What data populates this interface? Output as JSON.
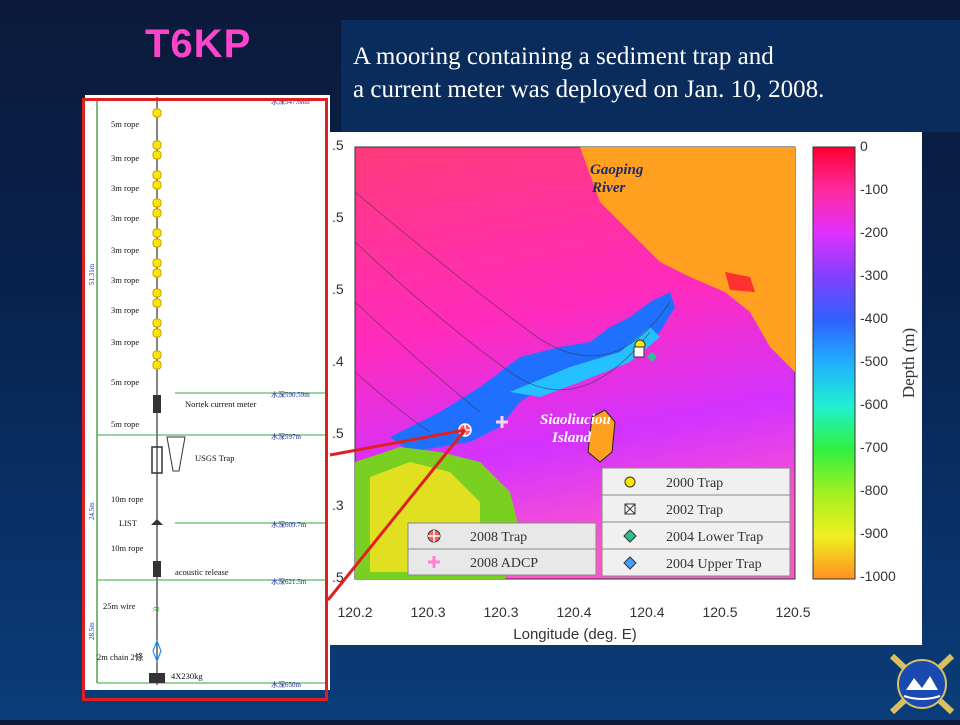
{
  "title": "T6KP",
  "caption": {
    "line1": "A mooring containing a sediment trap and",
    "line2": "a current meter was deployed on Jan. 10, 2008."
  },
  "mooring": {
    "ropes": [
      "5m rope",
      "3m rope",
      "3m rope",
      "3m rope",
      "3m rope",
      "3m rope",
      "3m rope",
      "3m rope",
      "5m rope",
      "5m rope",
      "10m rope",
      "10m rope",
      "25m wire",
      "2m chain 2條"
    ],
    "instruments": {
      "current_meter": "Nortek current meter",
      "trap": "USGS Trap",
      "list": "LIST",
      "release": "acoustic release",
      "anchor": "4X230kg"
    },
    "depths": [
      "水深547.68m",
      "水深590.59m",
      "水深597m",
      "水深609.7m",
      "水深621.5m",
      "水深650m"
    ],
    "lengths": [
      "51.31m",
      "24.5m",
      "28.5m"
    ]
  },
  "map": {
    "labels": {
      "river": [
        "Gaoping",
        "River"
      ],
      "island": [
        "Siaoliuciou",
        "Island"
      ]
    },
    "xlabel": "Longitude (deg. E)",
    "xticks": [
      "120.2",
      "120.3",
      "120.3",
      "120.4",
      "120.4",
      "120.5",
      "120.5"
    ],
    "yticks": [
      ".5",
      ".5",
      ".5",
      ".4",
      ".5",
      ".3",
      ".5"
    ],
    "legend_right": [
      {
        "label": "2000 Trap",
        "icon": "yellow-circle-icon"
      },
      {
        "label": "2002 Trap",
        "icon": "boxed-x-icon"
      },
      {
        "label": "2004 Lower Trap",
        "icon": "diamond-green-icon"
      },
      {
        "label": "2004 Upper Trap",
        "icon": "diamond-blue-icon"
      }
    ],
    "legend_left": [
      {
        "label": "2008 Trap",
        "icon": "circle-cross-icon"
      },
      {
        "label": "2008 ADCP",
        "icon": "pink-cross-icon"
      }
    ],
    "colorbar": {
      "label": "Depth (m)",
      "ticks": [
        "0",
        "-100",
        "-200",
        "-300",
        "-400",
        "-500",
        "-600",
        "-700",
        "-800",
        "-900",
        "-1000"
      ]
    }
  }
}
